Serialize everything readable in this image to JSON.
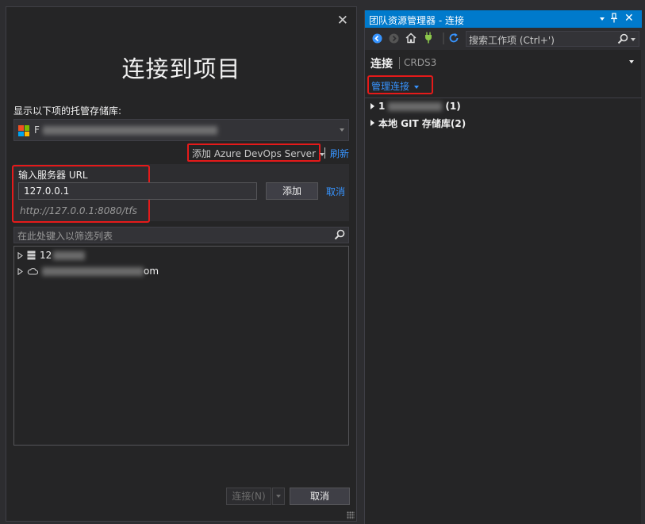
{
  "dialog": {
    "title": "连接到项目",
    "hosted_repos_label": "显示以下项的托管存储库:",
    "account_initial": "F",
    "add_server_label": "添加 Azure DevOps Server",
    "refresh_label": "刷新",
    "url_section": {
      "label": "输入服务器 URL",
      "value": "127.0.0.1",
      "add_button": "添加",
      "cancel_link": "取消",
      "example_hint": "http://127.0.0.1:8080/tfs"
    },
    "filter_placeholder": "在此处键入以筛选列表",
    "tree": [
      {
        "label_prefix": "12",
        "label_suffix": "",
        "icon": "server-icon"
      },
      {
        "label_prefix": "",
        "label_suffix": "om",
        "icon": "cloud-icon"
      }
    ],
    "connect_button": "连接(N)",
    "cancel_button": "取消",
    "close_glyph": "✕"
  },
  "team_explorer": {
    "title": "团队资源管理器 - 连接",
    "search_placeholder": "搜索工作项 (Ctrl+')",
    "heading": "连接",
    "heading_sub": "CRDS3",
    "manage_connections": "管理连接",
    "items": [
      {
        "label_prefix": "1",
        "label_suffix": "(1)"
      },
      {
        "label": "本地 GIT 存储库(2)"
      }
    ],
    "close_glyph": "✕"
  },
  "colors": {
    "accent": "#007acc",
    "link": "#3794ff",
    "highlight": "#e51a1a",
    "background": "#252526"
  }
}
